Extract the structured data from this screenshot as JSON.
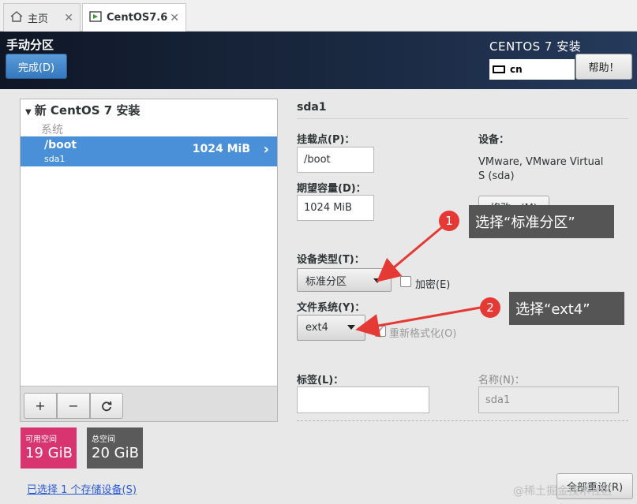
{
  "tabs": [
    {
      "label": "主页",
      "icon": "home-icon"
    },
    {
      "label": "CentOS7.6",
      "icon": "vm-icon"
    }
  ],
  "header": {
    "title": "手动分区",
    "done_label": "完成(D)",
    "installer_title": "CENTOS 7 安装",
    "keyboard": "cn",
    "help_label": "帮助！"
  },
  "tree": {
    "title": "新 CentOS 7 安装",
    "section": "系统",
    "items": [
      {
        "mount": "/boot",
        "device": "sda1",
        "size": "1024 MiB"
      }
    ]
  },
  "toolbar": {
    "add": "+",
    "remove": "−",
    "refresh": "⟳"
  },
  "space": {
    "available_label": "可用空间",
    "available_value": "19 GiB",
    "total_label": "总空间",
    "total_value": "20 GiB"
  },
  "storage_link": "已选择 1 个存储设备(S)",
  "detail": {
    "partition": "sda1",
    "mount_label": "挂载点(P)：",
    "mount_value": "/boot",
    "capacity_label": "期望容量(D)：",
    "capacity_value": "1024 MiB",
    "device_label": "设备：",
    "device_info": "VMware, VMware Virtual S (sda)",
    "modify_label": "修改...(M)",
    "device_type_label": "设备类型(T)：",
    "device_type_value": "标准分区",
    "encrypt_label": "加密(E)",
    "fs_label": "文件系统(Y)：",
    "fs_value": "ext4",
    "reformat_label": "重新格式化(O)",
    "tag_label": "标签(L)：",
    "tag_value": "",
    "name_label": "名称(N)：",
    "name_value": "sda1",
    "reset_label": "全部重设(R)"
  },
  "annotations": [
    {
      "num": "1",
      "text": "选择“标准分区”"
    },
    {
      "num": "2",
      "text": "选择“ext4”"
    }
  ],
  "watermark": "@稀土掘金技术社区",
  "colors": {
    "accent": "#4a90d9",
    "available": "#d8346f",
    "total": "#5a5a5a",
    "badge": "#e53935"
  }
}
